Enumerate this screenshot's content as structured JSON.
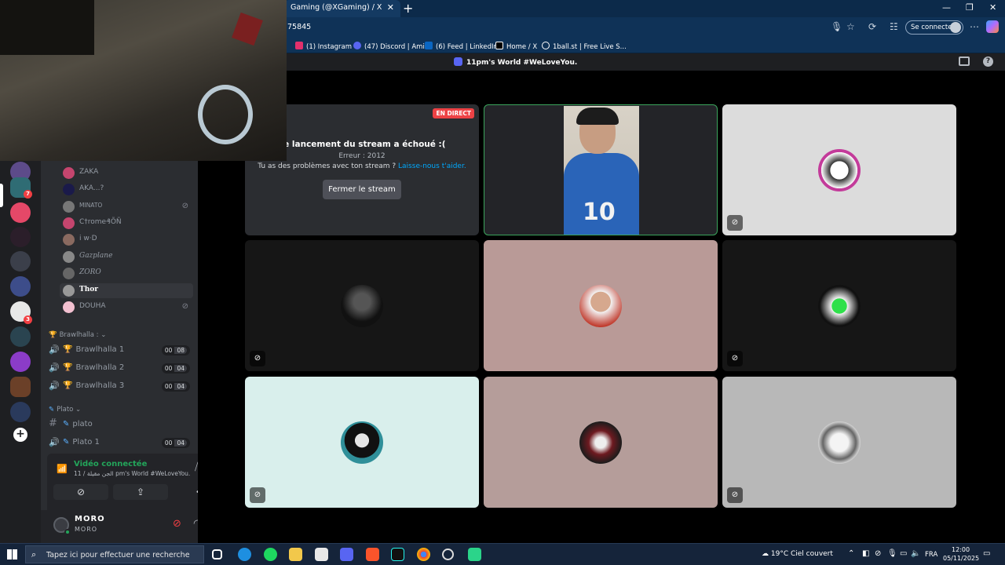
{
  "browser": {
    "tab_title": "Gaming (@XGaming) / X",
    "url_fragment": "75845",
    "signin_label": "Se connecter",
    "bookmarks": [
      "(1) Instagram",
      "(47) Discord | Amis",
      "(6) Feed | LinkedIn",
      "Home / X",
      "1ball.st | Free Live S..."
    ]
  },
  "discord": {
    "server_title": "11pm's World #WeLoveYou.",
    "members": [
      "ZAKA",
      "AKA...?",
      "MINATO",
      "C†rome₰ÕÑ",
      "i w·D",
      "Gazplane",
      "ZORO",
      "Thor",
      "DOUHA"
    ],
    "categories": {
      "brawlhalla": "Brawlhalla :",
      "plato": "Plato"
    },
    "voice_channels": [
      {
        "name": "Brawlhalla 1",
        "count": "00",
        "limit": "08"
      },
      {
        "name": "Brawlhalla 2",
        "count": "00",
        "limit": "04"
      },
      {
        "name": "Brawlhalla 3",
        "count": "00",
        "limit": "04"
      },
      {
        "name": "plato"
      },
      {
        "name": "Plato 1",
        "count": "00",
        "limit": "04"
      }
    ],
    "voice_panel": {
      "status": "Vidéo connectée",
      "channel": "11 / الجن مقيلة pm's World #WeLoveYou."
    },
    "user": {
      "name": "MORO",
      "tag": "MORO"
    },
    "stream_error": {
      "badge": "EN DIRECT",
      "title": "Le lancement du stream a échoué :(",
      "code": "Erreur : 2012",
      "help_text": "Tu as des problèmes avec ton stream ?",
      "help_link": "Laisse-nous t'aider.",
      "button": "Fermer le stream"
    },
    "cam_jersey_number": "10",
    "colors": {
      "accent": "#5865f2",
      "connected": "#23a55a",
      "live": "#ed4245",
      "link": "#00a8fc"
    }
  },
  "taskbar": {
    "search_placeholder": "Tapez ici pour effectuer une recherche",
    "weather": "19°C  Ciel couvert",
    "language": "FRA",
    "time": "12:00",
    "date": "05/11/2025"
  }
}
